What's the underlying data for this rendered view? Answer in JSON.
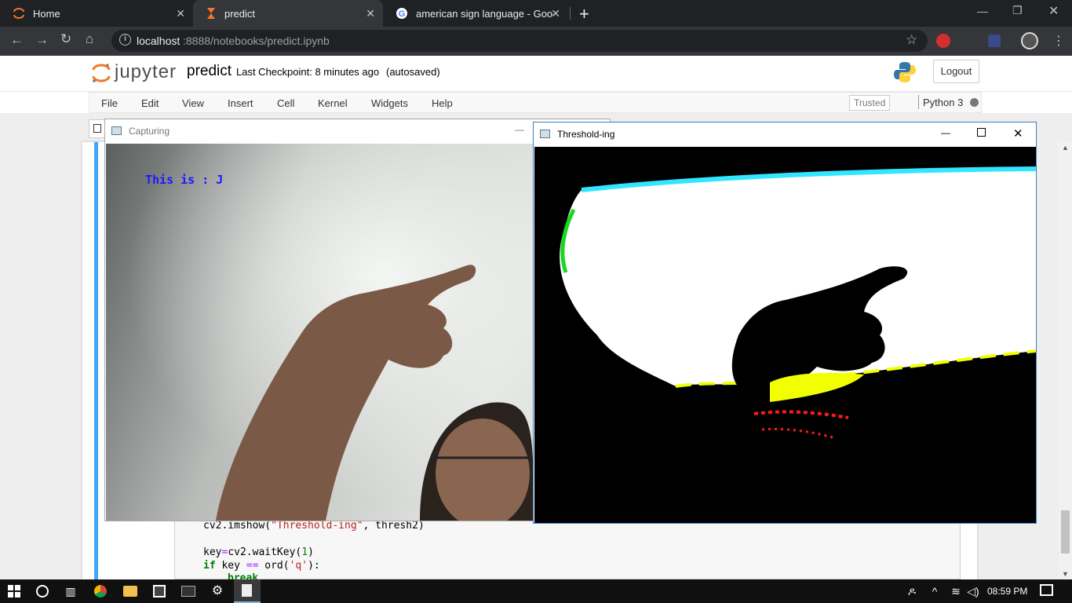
{
  "browser": {
    "tabs": [
      {
        "label": "Home",
        "icon": "jupyter-logo-icon"
      },
      {
        "label": "predict",
        "icon": "hourglass-icon"
      },
      {
        "label": "american sign language - Google",
        "icon": "google-g-icon"
      }
    ],
    "url_host": "localhost",
    "url_rest": ":8888/notebooks/predict.ipynb"
  },
  "jupyter": {
    "logo_text": "jupyter",
    "notebook_name": "predict",
    "checkpoint_text": "Last Checkpoint: 8 minutes ago",
    "autosaved_text": "(autosaved)",
    "logout_label": "Logout",
    "menu": [
      "File",
      "Edit",
      "View",
      "Insert",
      "Cell",
      "Kernel",
      "Widgets",
      "Help"
    ],
    "trusted_label": "Trusted",
    "kernel_label": "Python 3"
  },
  "code": {
    "line1_pre": "cv2.imshow(",
    "line1_str": "\"Threshold-ing\"",
    "line1_post": ", thresh2)",
    "line2_pre": "key",
    "line2_op": "=",
    "line2_mid": "cv2.waitKey(",
    "line2_num": "1",
    "line2_post": ")",
    "line3_kw": "if",
    "line3_mid": " key ",
    "line3_op": "==",
    "line3_fn": " ord(",
    "line3_str": "'q'",
    "line3_post": "):",
    "line4_kw": "break"
  },
  "windows": {
    "capturing_title": "Capturing",
    "capturing_overlay": "This is : J",
    "threshold_title": "Threshold-ing"
  },
  "taskbar": {
    "clock": "08:59 PM"
  },
  "colors": {
    "cell_accent": "#42a5f5",
    "overlay_text": "#1a1aff"
  }
}
